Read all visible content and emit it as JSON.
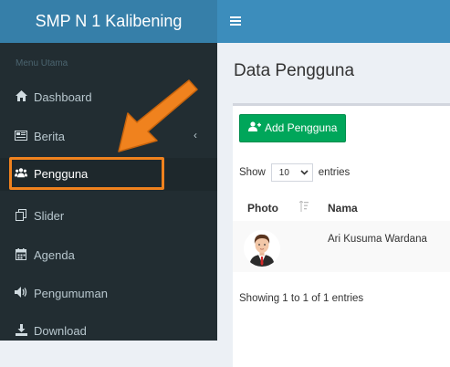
{
  "app": {
    "brand": "SMP N 1 Kalibening",
    "menu_icon": "hamburger-icon"
  },
  "sidebar": {
    "header": "Menu Utama",
    "items": [
      {
        "label": "Dashboard",
        "icon": "home-icon"
      },
      {
        "label": "Berita",
        "icon": "newspaper-icon",
        "chevron": "‹"
      },
      {
        "label": "Pengguna",
        "icon": "users-icon"
      },
      {
        "label": "Slider",
        "icon": "copy-icon"
      },
      {
        "label": "Agenda",
        "icon": "calendar-icon"
      },
      {
        "label": "Pengumuman",
        "icon": "volume-icon"
      },
      {
        "label": "Download",
        "icon": "download-icon"
      }
    ]
  },
  "annotation": {
    "color": "#f0821e"
  },
  "main": {
    "title": "Data Pengguna",
    "add_button": "Add Pengguna",
    "show_label": "Show",
    "entries_value": "10",
    "entries_label": "entries",
    "table": {
      "headers": [
        "Photo",
        "Nama"
      ],
      "rows": [
        {
          "nama": "Ari Kusuma Wardana"
        }
      ]
    },
    "info": "Showing 1 to 1 of 1 entries"
  },
  "colors": {
    "sidebar": "#222d32",
    "brand": "#367fa9",
    "topbar": "#3c8dbc",
    "success": "#00a65a"
  }
}
